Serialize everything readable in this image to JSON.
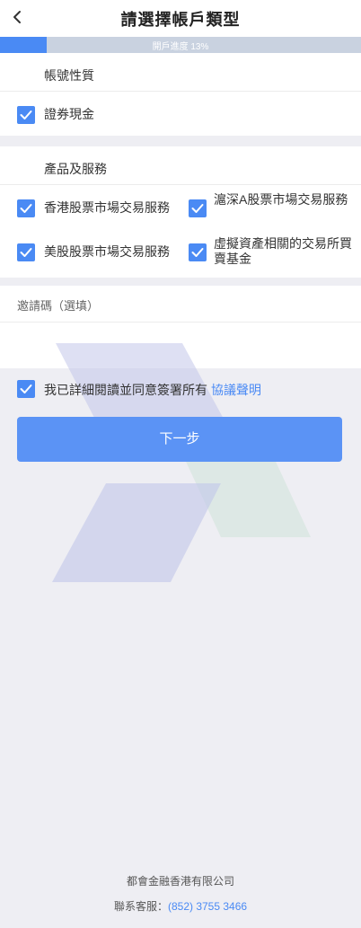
{
  "header": {
    "title": "請選擇帳戶類型"
  },
  "progress": {
    "text": "開戶進度 13%",
    "percent": 13
  },
  "account_nature": {
    "title": "帳號性質",
    "options": [
      {
        "label": "證券現金",
        "checked": true
      }
    ]
  },
  "products": {
    "title": "產品及服務",
    "options": [
      {
        "label": "香港股票市場交易服務",
        "checked": true
      },
      {
        "label": "滬深A股票市場交易服務",
        "checked": true
      },
      {
        "label": "美股股票市場交易服務",
        "checked": true
      },
      {
        "label": "虛擬資產相關的交易所買賣基金",
        "checked": true
      }
    ]
  },
  "invite": {
    "title": "邀請碼（選填）",
    "value": ""
  },
  "agreement": {
    "text": "我已詳細閱讀並同意簽署所有",
    "link": "協議聲明",
    "checked": true
  },
  "next_button": {
    "label": "下一步"
  },
  "footer": {
    "company": "都會金融香港有限公司",
    "service_label": "聯系客服：",
    "phone": "(852) 3755 3466"
  },
  "colors": {
    "accent": "#4a8af4",
    "button": "#5b93f5",
    "background": "#eeeef3"
  }
}
